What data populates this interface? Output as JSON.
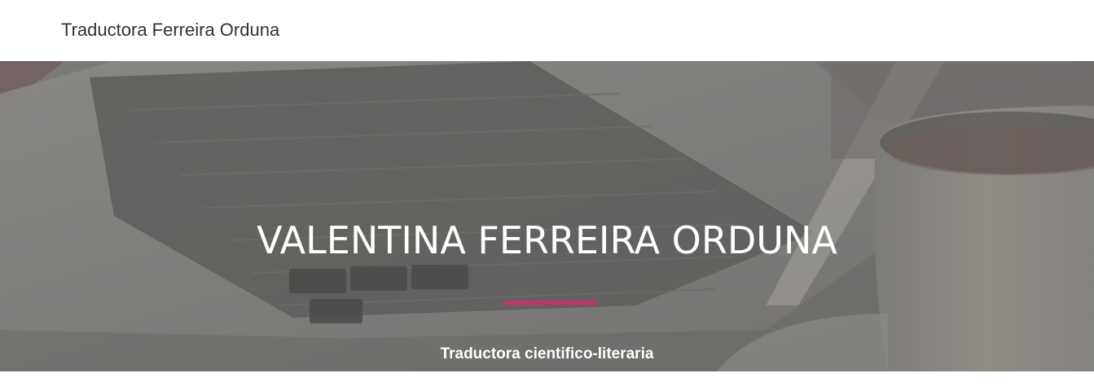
{
  "header": {
    "brand": "Traductora Ferreira Orduna"
  },
  "hero": {
    "title": "VALENTINA FERREIRA ORDUNA",
    "subtitle": "Traductora cientifico-literaria",
    "background_image": "laptop-keyboard-and-coffee-cup-photo",
    "accent_color": "#c7306f"
  }
}
